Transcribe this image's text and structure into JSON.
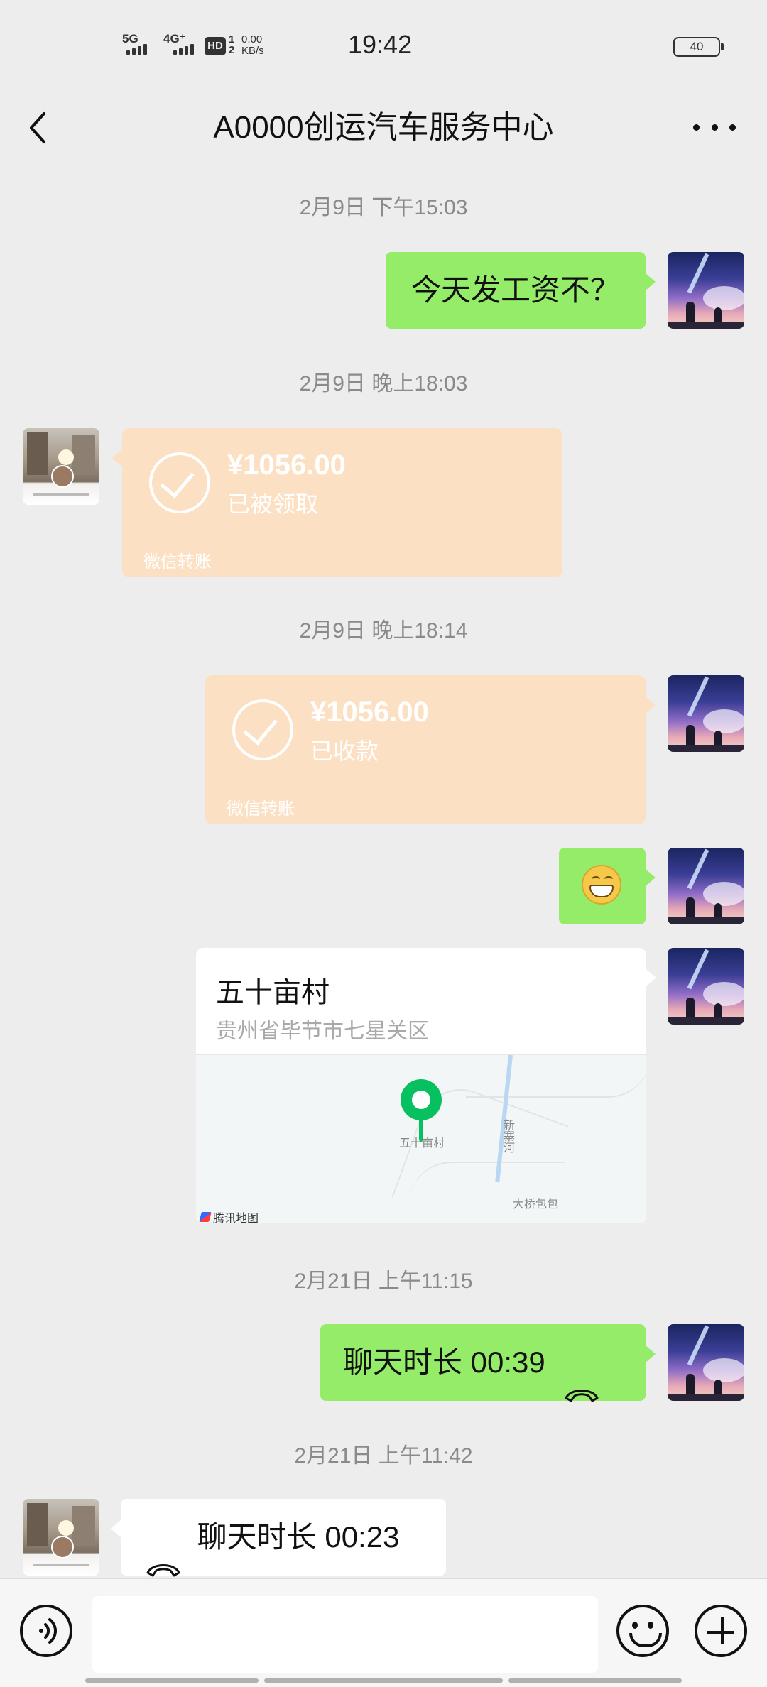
{
  "status_bar": {
    "net1": "5G",
    "net2": "4G⁺",
    "hd": "HD",
    "hd_sim": "1\n2",
    "speed_value": "0.00",
    "speed_unit": "KB/s",
    "time": "19:42",
    "battery": "40"
  },
  "header": {
    "title": "A0000创运汽车服务中心",
    "back_icon": "chevron-left-icon",
    "more_icon": "more-horizontal-icon"
  },
  "messages": [
    {
      "type": "timestamp",
      "text": "2月9日 下午15:03"
    },
    {
      "type": "text",
      "from": "me",
      "text": "今天发工资不？"
    },
    {
      "type": "timestamp",
      "text": "2月9日 晚上18:03"
    },
    {
      "type": "transfer",
      "from": "other",
      "amount": "¥1056.00",
      "status": "已被领取",
      "source": "微信转账"
    },
    {
      "type": "timestamp",
      "text": "2月9日 晚上18:14"
    },
    {
      "type": "transfer",
      "from": "me",
      "amount": "¥1056.00",
      "status": "已收款",
      "source": "微信转账"
    },
    {
      "type": "emoji",
      "from": "me",
      "emoji": "grinning-face"
    },
    {
      "type": "location",
      "from": "me",
      "name": "五十亩村",
      "address": "贵州省毕节市七星关区",
      "map_pin_label": "五十亩村",
      "map_river_label": "新寨河",
      "map_place_label": "大桥包包",
      "map_provider": "腾讯地图"
    },
    {
      "type": "timestamp",
      "text": "2月21日 上午11:15"
    },
    {
      "type": "call",
      "from": "me",
      "text": "聊天时长 00:39"
    },
    {
      "type": "timestamp",
      "text": "2月21日 上午11:42"
    },
    {
      "type": "call",
      "from": "other",
      "text": "聊天时长 00:23"
    }
  ],
  "input_bar": {
    "voice_icon": "voice-icon",
    "emoji_icon": "emoji-icon",
    "plus_icon": "plus-icon",
    "input_value": ""
  },
  "colors": {
    "background": "#ededed",
    "my_bubble": "#95ec69",
    "transfer_card": "#fce0c4",
    "accent_green": "#07c160"
  }
}
